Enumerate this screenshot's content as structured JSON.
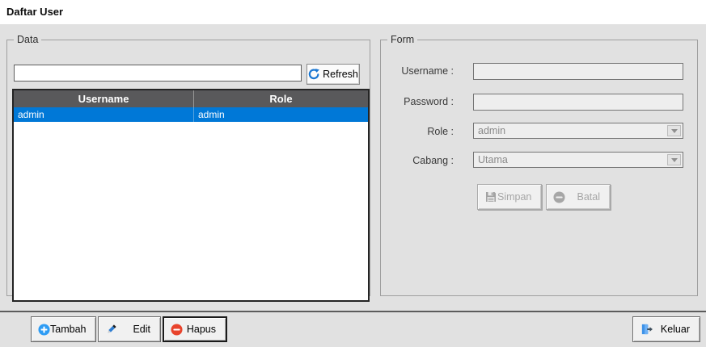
{
  "window": {
    "title": "Daftar User"
  },
  "colors": {
    "panel_gray": "#e1e1e1",
    "grid_header_gray": "#59595b",
    "selection_blue": "#0078d7",
    "add_icon_blue": "#2e9cf4",
    "delete_icon_red": "#e8432c",
    "refresh_icon_blue": "#1976d2",
    "exit_icon_blue": "#3f93e8"
  },
  "data_group": {
    "label": "Data",
    "search": {
      "value": ""
    },
    "refresh_button": {
      "label": "Refresh"
    },
    "table": {
      "columns": [
        "Username",
        "Role"
      ],
      "rows": [
        {
          "username": "admin",
          "role": "admin"
        }
      ],
      "selected_row_index": 0
    }
  },
  "form_group": {
    "label": "Form",
    "username": {
      "label": "Username :",
      "value": ""
    },
    "password": {
      "label": "Password :",
      "value": ""
    },
    "role": {
      "label": "Role :",
      "selected": "admin"
    },
    "cabang": {
      "label": "Cabang :",
      "selected": "Utama"
    },
    "simpan_button": {
      "label": "Simpan"
    },
    "batal_button": {
      "label": "Batal"
    }
  },
  "footer": {
    "tambah_button": {
      "label": "Tambah"
    },
    "edit_button": {
      "label": "Edit"
    },
    "hapus_button": {
      "label": "Hapus"
    },
    "keluar_button": {
      "label": "Keluar"
    }
  }
}
